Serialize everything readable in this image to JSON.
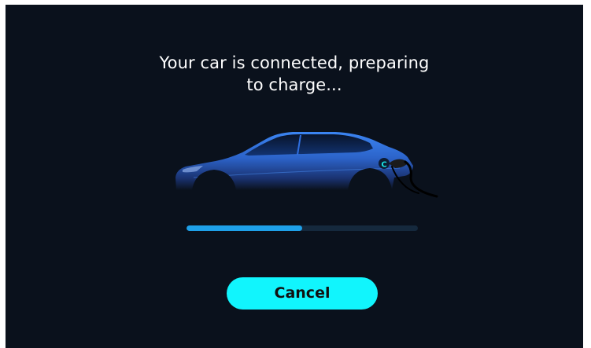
{
  "message": {
    "line1": "Your car is connected, preparing",
    "line2": "to charge..."
  },
  "charge_progress": {
    "fraction": 0.5
  },
  "actions": {
    "cancel_label": "Cancel"
  },
  "icons": {
    "car": "car-illustration",
    "plug": "charging-plug-icon",
    "charge_port": "charge-port-c-icon"
  },
  "colors": {
    "background": "#0a111c",
    "car_blue": "#2f74e4",
    "progress_fill": "#1ea0e8",
    "progress_track": "#15293d",
    "button": "#11f5fd",
    "port_accent": "#19e6e6"
  }
}
